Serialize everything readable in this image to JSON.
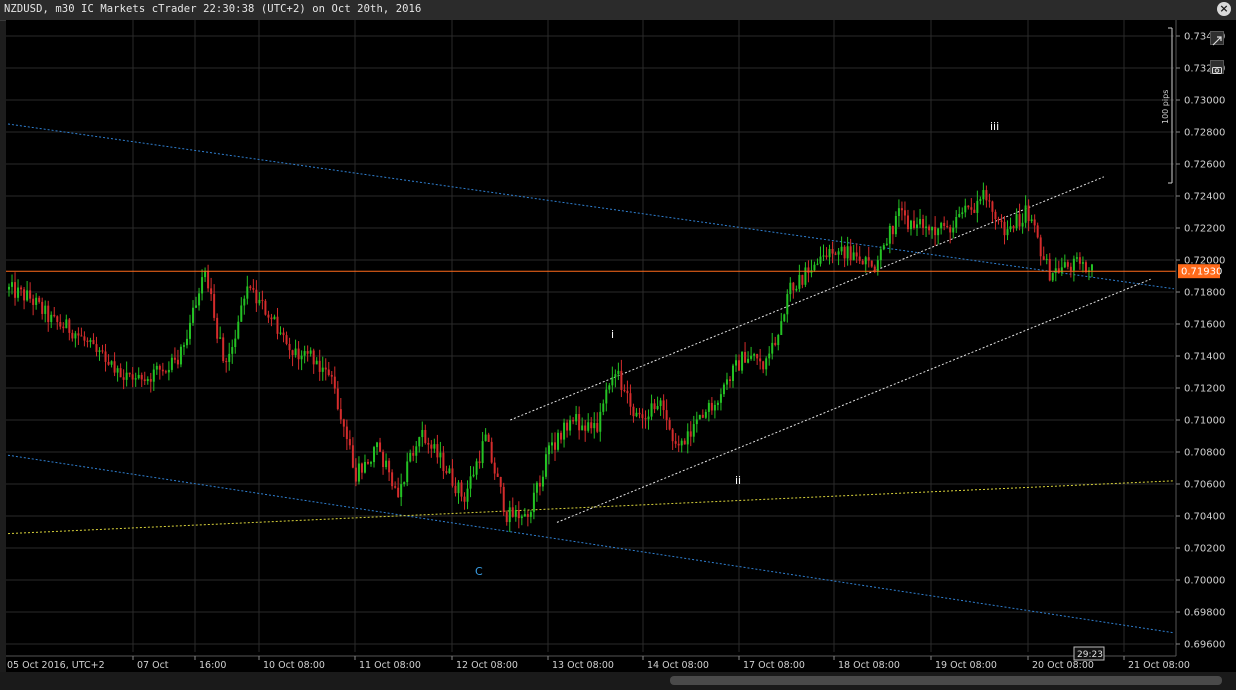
{
  "window": {
    "title": "NZDUSD, m30 IC Markets cTrader 22:30:38 (UTC+2) on Oct 20th, 2016",
    "close_glyph": "×"
  },
  "toolbar": {
    "icons": [
      "expand-icon",
      "camera-icon"
    ]
  },
  "price_axis": {
    "ticks": [
      "0.73400",
      "0.73200",
      "0.73000",
      "0.72800",
      "0.72600",
      "0.72400",
      "0.72200",
      "0.72000",
      "0.71800",
      "0.71600",
      "0.71400",
      "0.71200",
      "0.71000",
      "0.70800",
      "0.70600",
      "0.70400",
      "0.70200",
      "0.70000",
      "0.69800",
      "0.69600"
    ],
    "current_price": "0.71930",
    "pips_label": "100 pips"
  },
  "time_axis": {
    "ticks": [
      "05 Oct 2016, UTC+2",
      "07 Oct",
      "16:00",
      "10 Oct 08:00",
      "11 Oct 08:00",
      "12 Oct 08:00",
      "13 Oct 08:00",
      "14 Oct 08:00",
      "17 Oct 08:00",
      "18 Oct 08:00",
      "19 Oct 08:00",
      "20 Oct 08:00",
      "21 Oct 08:00"
    ],
    "countdown": "29:23"
  },
  "wave_labels": [
    {
      "text": "iii",
      "color": "#ffffff"
    },
    {
      "text": "i",
      "color": "#ffffff"
    },
    {
      "text": "ii",
      "color": "#ffffff"
    },
    {
      "text": "C",
      "color": "#3aa0e8"
    }
  ],
  "colors": {
    "background": "#000000",
    "grid": "#2a2a2a",
    "bull": "#24c324",
    "bear": "#d42c2c",
    "price_line": "#ff6a1a",
    "blue_channel": "#2f7fd0",
    "white_channel": "#e6e6e6",
    "yellow_line": "#d8d23a"
  },
  "chart_data": {
    "type": "candlestick",
    "symbol": "NZDUSD",
    "timeframe": "m30",
    "ylim": [
      0.6955,
      0.735
    ],
    "current_price": 0.7193,
    "anchors": [
      [
        0.718,
        0.7183
      ],
      [
        0.7175,
        0.7177
      ],
      [
        0.716,
        0.7163
      ],
      [
        0.7155,
        0.7157
      ],
      [
        0.714,
        0.7143
      ],
      [
        0.7127,
        0.713
      ],
      [
        0.7123,
        0.7124
      ],
      [
        0.713,
        0.7134
      ],
      [
        0.714,
        0.7142
      ],
      [
        0.7195,
        0.7196
      ],
      [
        0.713,
        0.7131
      ],
      [
        0.718,
        0.7182
      ],
      [
        0.7165,
        0.7168
      ],
      [
        0.714,
        0.7143
      ],
      [
        0.714,
        0.7142
      ],
      [
        0.712,
        0.7124
      ],
      [
        0.7065,
        0.7068
      ],
      [
        0.708,
        0.7083
      ],
      [
        0.7052,
        0.706
      ],
      [
        0.709,
        0.7092
      ],
      [
        0.707,
        0.7077
      ],
      [
        0.705,
        0.7052
      ],
      [
        0.7087,
        0.709
      ],
      [
        0.704,
        0.704
      ],
      [
        0.704,
        0.7043
      ],
      [
        0.7082,
        0.7084
      ],
      [
        0.71,
        0.7101
      ],
      [
        0.709,
        0.7094
      ],
      [
        0.7128,
        0.7132
      ],
      [
        0.71,
        0.7105
      ],
      [
        0.7108,
        0.7112
      ],
      [
        0.708,
        0.7082
      ],
      [
        0.71,
        0.7102
      ],
      [
        0.712,
        0.7123
      ],
      [
        0.714,
        0.7142
      ],
      [
        0.7132,
        0.7137
      ],
      [
        0.718,
        0.7182
      ],
      [
        0.7192,
        0.7196
      ],
      [
        0.7205,
        0.721
      ],
      [
        0.72,
        0.7204
      ],
      [
        0.7195,
        0.7197
      ],
      [
        0.7225,
        0.723
      ],
      [
        0.722,
        0.7222
      ],
      [
        0.7215,
        0.7221
      ],
      [
        0.7225,
        0.723
      ],
      [
        0.7238,
        0.7242
      ],
      [
        0.7215,
        0.7218
      ],
      [
        0.723,
        0.7233
      ],
      [
        0.719,
        0.7195
      ],
      [
        0.7196,
        0.7197
      ],
      [
        0.7193,
        0.7193
      ]
    ],
    "lines": [
      {
        "name": "blue-upper-channel",
        "style": "dotted",
        "from": [
          0,
          0.7285
        ],
        "to": [
          1,
          0.7182
        ]
      },
      {
        "name": "blue-lower-channel",
        "style": "dotted",
        "from": [
          0,
          0.7078
        ],
        "to": [
          1,
          0.6967
        ]
      },
      {
        "name": "white-upper-channel",
        "style": "dotted",
        "from": [
          0.43,
          0.71
        ],
        "to": [
          0.94,
          0.7252
        ]
      },
      {
        "name": "white-lower-channel",
        "style": "dotted",
        "from": [
          0.47,
          0.7036
        ],
        "to": [
          0.98,
          0.7188
        ]
      },
      {
        "name": "yellow-support",
        "style": "dotted",
        "from": [
          0,
          0.7029
        ],
        "to": [
          1,
          0.7062
        ]
      }
    ]
  }
}
